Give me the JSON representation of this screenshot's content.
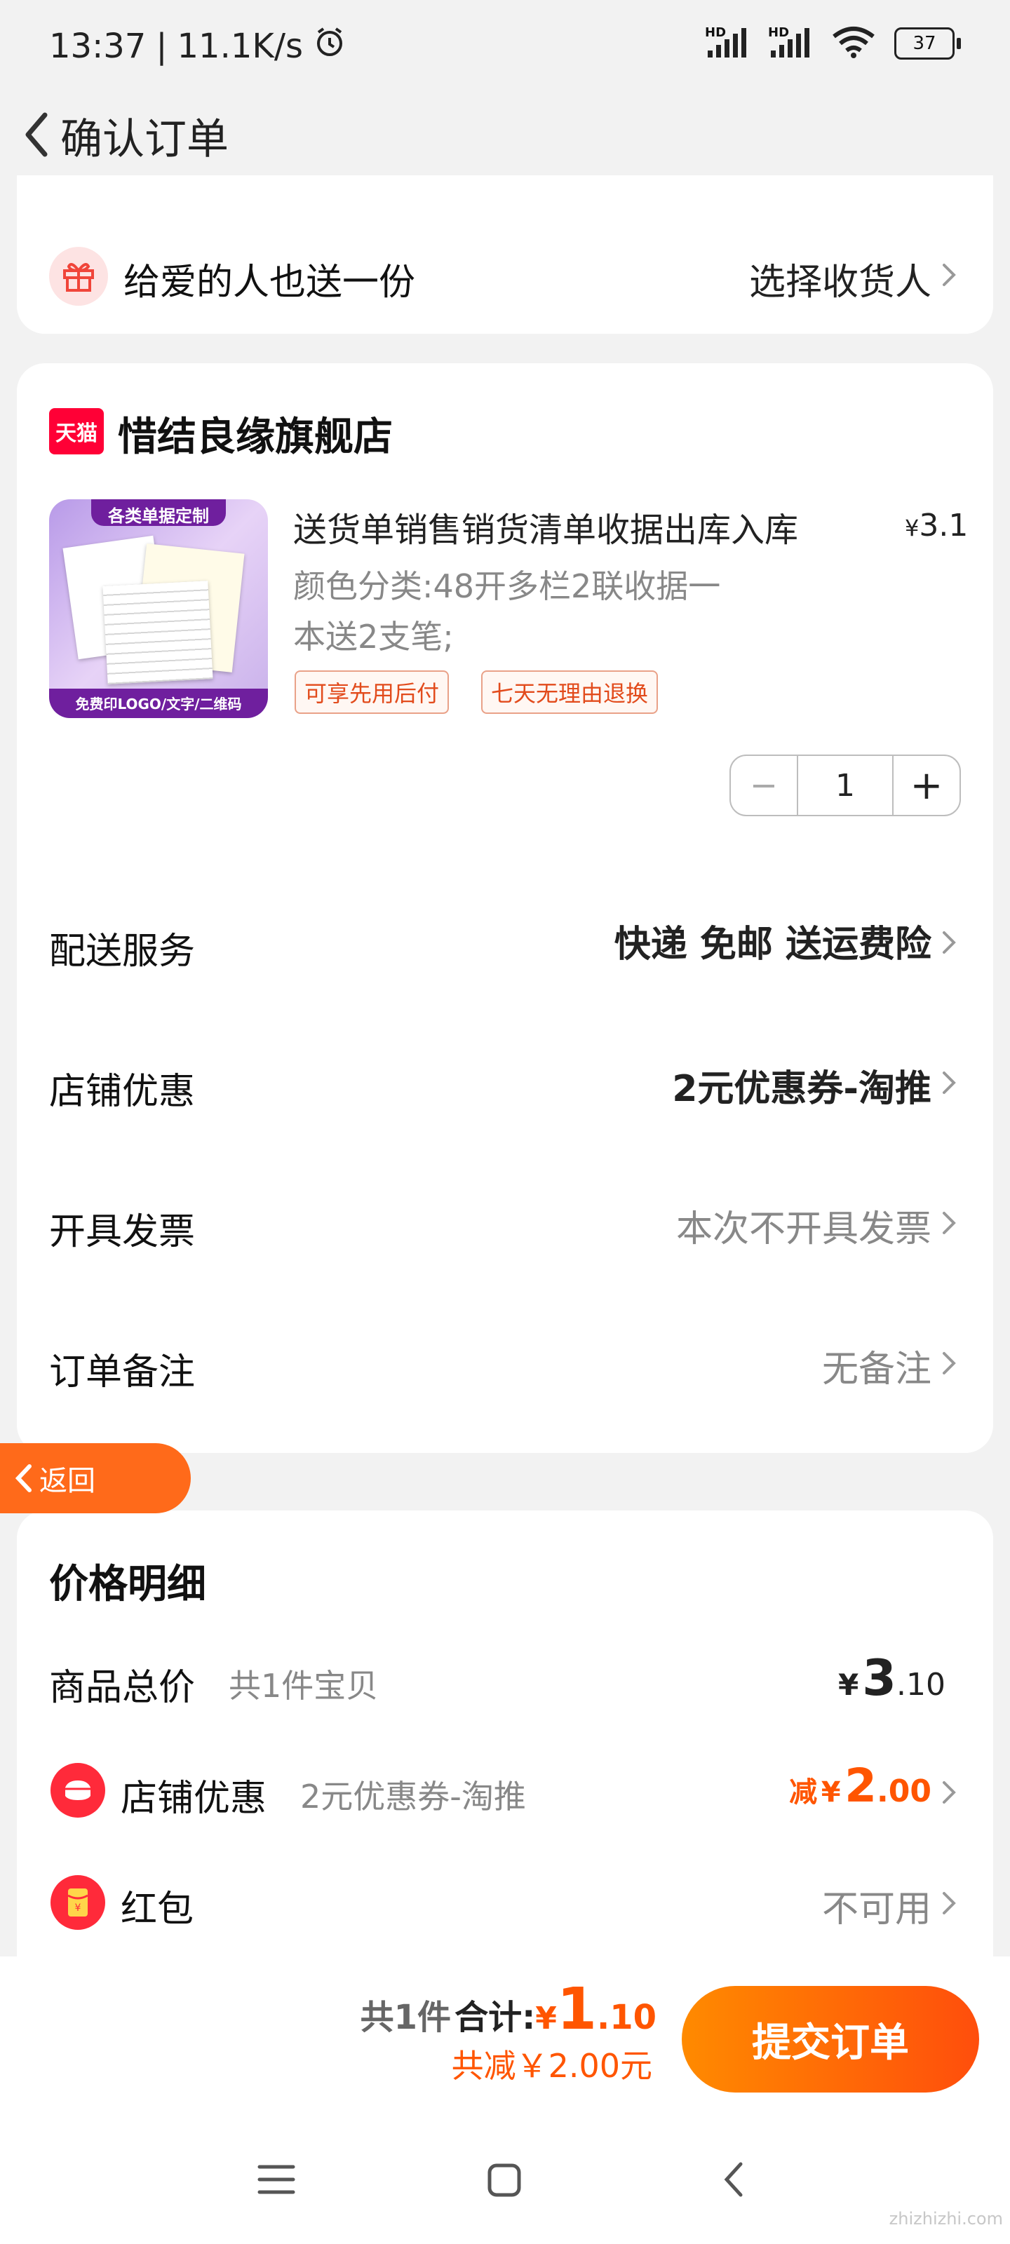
{
  "status_bar": {
    "time": "13:37",
    "net_speed": "11.1K/s",
    "battery": "37",
    "hd1": "HD",
    "hd2": "HD"
  },
  "header": {
    "title": "确认订单"
  },
  "gift_row": {
    "label": "给爱的人也送一份",
    "action": "选择收货人"
  },
  "store": {
    "badge": "天猫",
    "name": "惜结良缘旗舰店",
    "product": {
      "image_top_text": "各类单据定制",
      "image_bottom_text": "免费印LOGO/文字/二维码",
      "title": "送货单销售销货清单收据出库入库",
      "price_symbol": "¥",
      "price": "3.1",
      "variant_line1": "颜色分类:48开多栏2联收据一",
      "variant_line2": "本送2支笔;",
      "tags": [
        "可享先用后付",
        "七天无理由退换"
      ],
      "quantity": "1",
      "minus": "−",
      "plus": "+"
    },
    "rows": [
      {
        "label": "配送服务",
        "value": "快递 免邮 送运费险"
      },
      {
        "label": "店铺优惠",
        "value": "2元优惠券-淘推"
      },
      {
        "label": "开具发票",
        "value": "本次不开具发票"
      },
      {
        "label": "订单备注",
        "value": "无备注"
      }
    ]
  },
  "floating_back": {
    "label": "返回"
  },
  "price_detail": {
    "title": "价格明细",
    "total_label": "商品总价",
    "total_note": "共1件宝贝",
    "total_symbol": "¥",
    "total_int": "3",
    "total_dec": ".10",
    "discount_label": "店铺优惠",
    "discount_note": "2元优惠券-淘推",
    "discount_prefix": "减",
    "discount_symbol": "¥",
    "discount_int": "2",
    "discount_dec": ".00",
    "redpacket_label": "红包",
    "redpacket_value": "不可用"
  },
  "footer": {
    "count": "共1件",
    "total_label": "合计:",
    "total_symbol": "¥",
    "total_int": "1",
    "total_dec": ".10",
    "saved": "共减￥2.00元",
    "submit": "提交订单"
  },
  "watermark": {
    "text": "zhizhizhi.com"
  },
  "colors": {
    "accent": "#ff5500",
    "button_start": "#ff8a00",
    "button_end": "#ff4e0c"
  }
}
